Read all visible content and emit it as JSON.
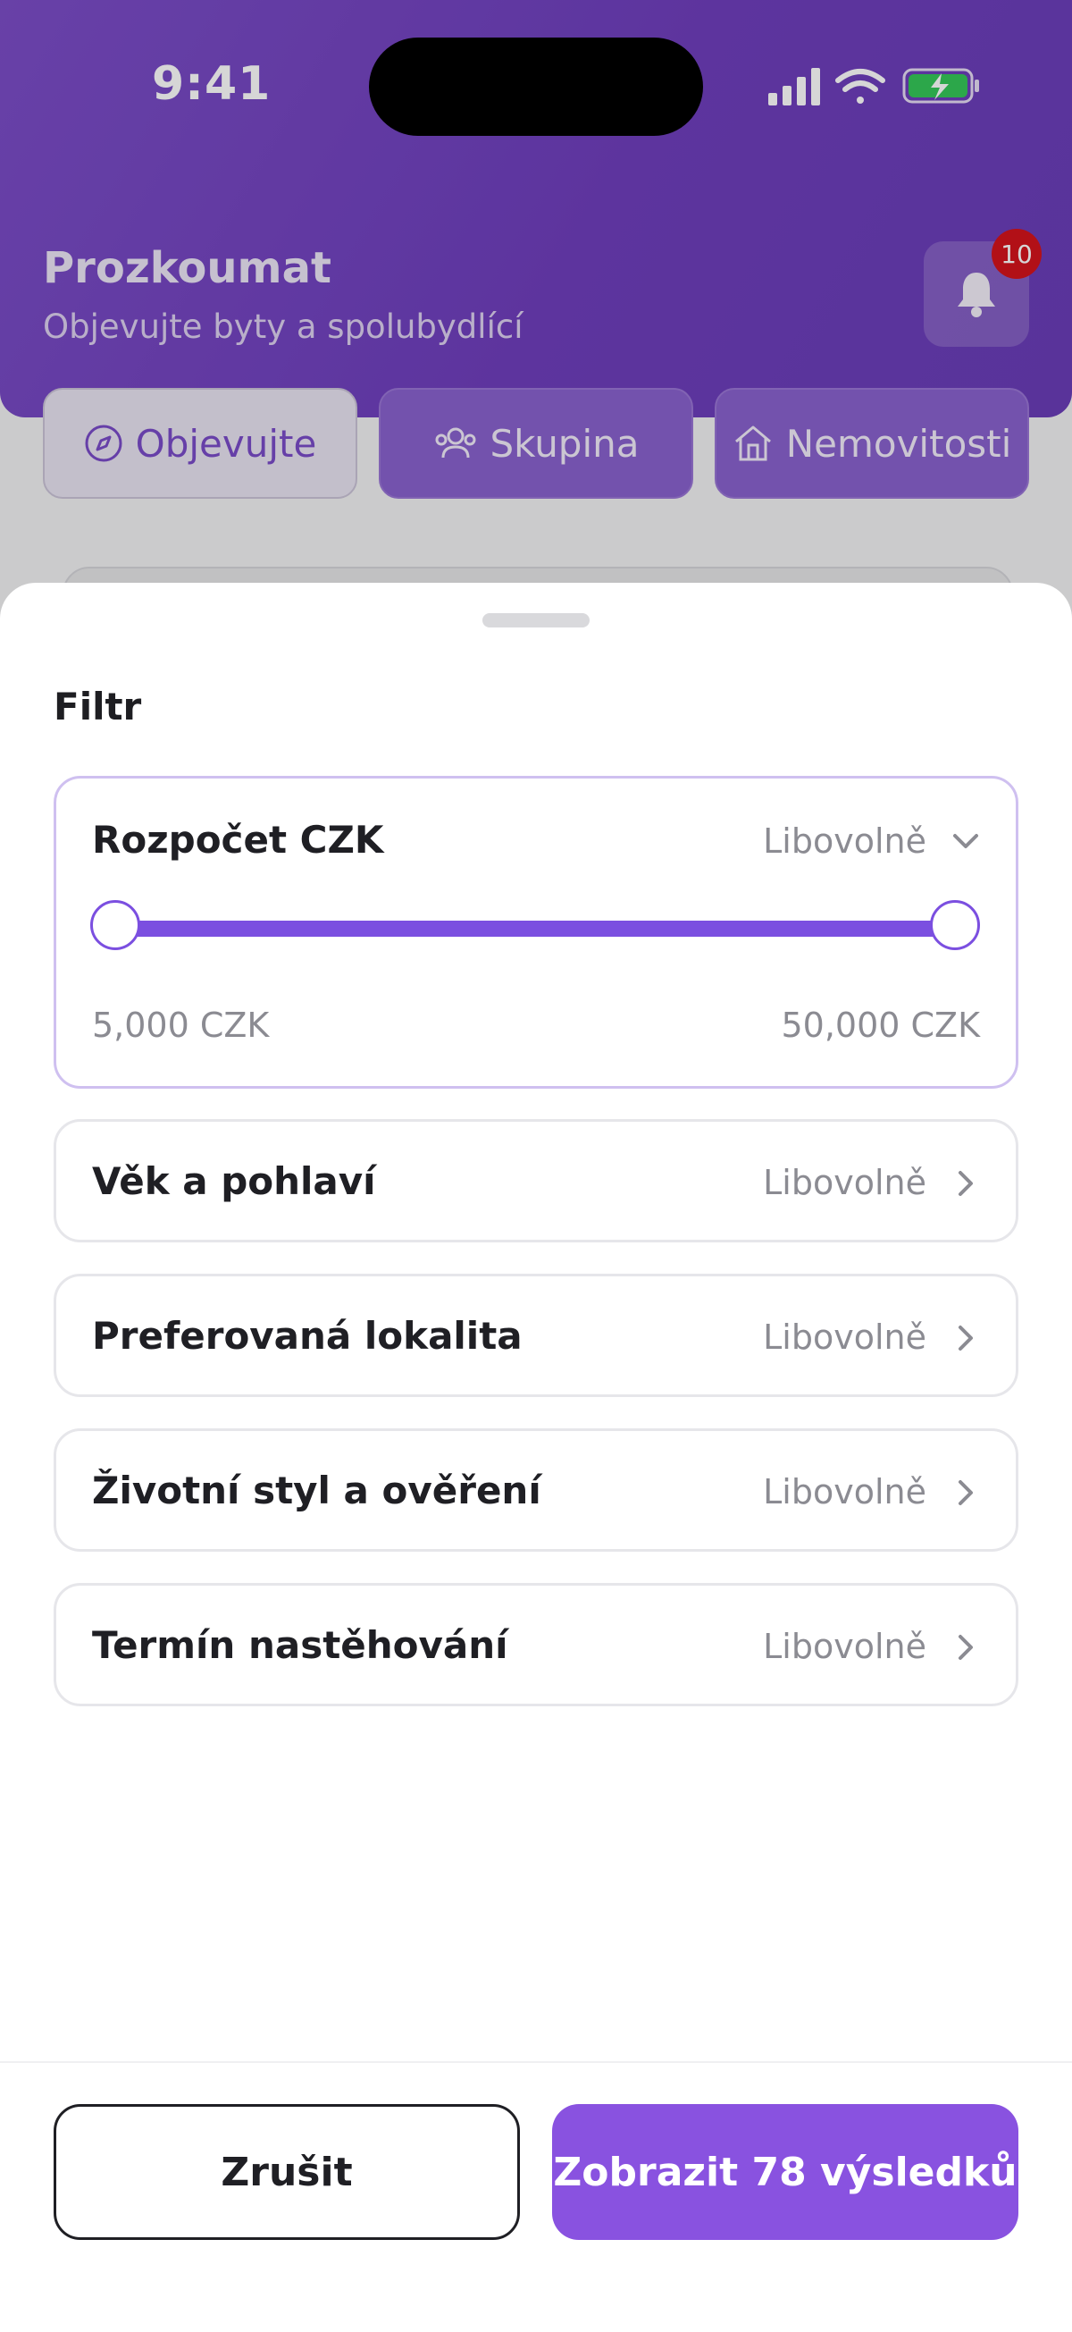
{
  "status_bar": {
    "time": "9:41"
  },
  "header": {
    "title": "Prozkoumat",
    "subtitle": "Objevujte byty a spolubydlící",
    "notification_count": "10"
  },
  "tabs": [
    {
      "label": "Objevujte",
      "icon": "compass-icon",
      "active": true
    },
    {
      "label": "Skupina",
      "icon": "group-icon",
      "active": false
    },
    {
      "label": "Nemovitosti",
      "icon": "house-icon",
      "active": false
    }
  ],
  "sheet": {
    "title": "Filtr",
    "budget": {
      "label": "Rozpočet CZK",
      "value": "Libovolně",
      "min_label": "5,000 CZK",
      "max_label": "50,000 CZK",
      "selected_min_fraction": 0,
      "selected_max_fraction": 1
    },
    "rows": [
      {
        "label": "Věk a pohlaví",
        "value": "Libovolně"
      },
      {
        "label": "Preferovaná lokalita",
        "value": "Libovolně"
      },
      {
        "label": "Životní styl a ověření",
        "value": "Libovolně"
      },
      {
        "label": "Termín nastěhování",
        "value": "Libovolně"
      }
    ]
  },
  "actions": {
    "cancel_label": "Zrušit",
    "show_label": "Zobrazit 78 výsledků"
  },
  "colors": {
    "accent": "#8952e0",
    "header": "#6f3fbd",
    "badge": "#d5141c"
  }
}
